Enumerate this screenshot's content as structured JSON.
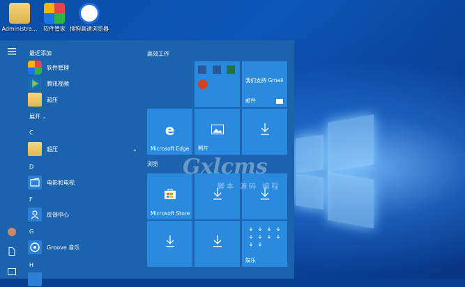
{
  "desktop": {
    "icons": [
      {
        "label": "Administra..."
      },
      {
        "label": "软件管家"
      },
      {
        "label": "搜狗高速浏览器"
      }
    ]
  },
  "start_menu": {
    "recent_title": "最近添加",
    "recent_apps": [
      {
        "label": "软件管理"
      },
      {
        "label": "腾讯视频"
      },
      {
        "label": "超压"
      }
    ],
    "expand_label": "展开",
    "groups": [
      {
        "letter": "C",
        "apps": [
          {
            "label": "超压"
          }
        ]
      },
      {
        "letter": "D",
        "apps": [
          {
            "label": "电影和电视"
          }
        ]
      },
      {
        "letter": "F",
        "apps": [
          {
            "label": "反馈中心"
          }
        ]
      },
      {
        "letter": "G",
        "apps": [
          {
            "label": "Groove 音乐"
          }
        ]
      },
      {
        "letter": "H",
        "apps": []
      }
    ],
    "tiles_group1_title": "高效工作",
    "tiles_group2_title": "浏览",
    "tiles": {
      "gmail_text": "我们支持 Gmail",
      "mail_label": "邮件",
      "edge_label": "Microsoft Edge",
      "photos_label": "照片",
      "store_label": "Microsoft Store",
      "entertainment_label": "娱乐"
    }
  },
  "watermark": {
    "main": "Gxlcms",
    "sub": "脚本 源码 编程"
  }
}
